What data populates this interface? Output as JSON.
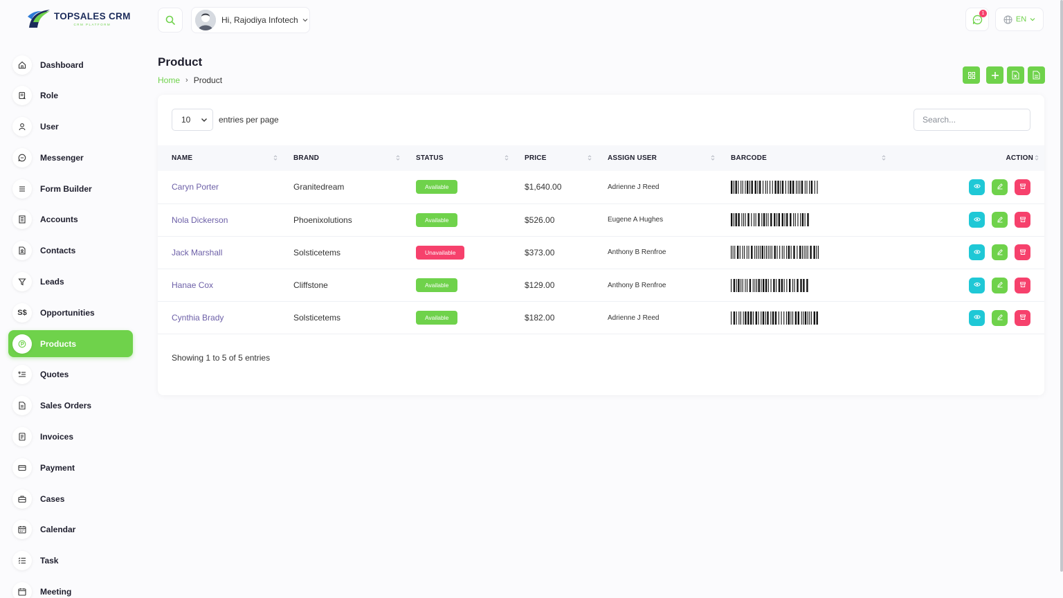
{
  "brand": {
    "title": "TOPSALES CRM",
    "subtitle": "CRM PLATFORM"
  },
  "header": {
    "greeting": "Hi, Rajodiya Infotech",
    "notifications": "1",
    "language": "EN"
  },
  "sidebar": {
    "items": [
      {
        "label": "Dashboard",
        "icon": "home-icon"
      },
      {
        "label": "Role",
        "icon": "role-icon"
      },
      {
        "label": "User",
        "icon": "user-icon"
      },
      {
        "label": "Messenger",
        "icon": "message-icon"
      },
      {
        "label": "Form Builder",
        "icon": "menu-icon"
      },
      {
        "label": "Accounts",
        "icon": "building-icon"
      },
      {
        "label": "Contacts",
        "icon": "file-user-icon"
      },
      {
        "label": "Leads",
        "icon": "filter-icon"
      },
      {
        "label": "Opportunities",
        "icon": "currency-icon",
        "glyph": "S$"
      },
      {
        "label": "Products",
        "icon": "product-icon",
        "active": true
      },
      {
        "label": "Quotes",
        "icon": "quote-icon"
      },
      {
        "label": "Sales Orders",
        "icon": "order-icon"
      },
      {
        "label": "Invoices",
        "icon": "invoice-icon"
      },
      {
        "label": "Payment",
        "icon": "credit-card-icon"
      },
      {
        "label": "Cases",
        "icon": "briefcase-icon"
      },
      {
        "label": "Calendar",
        "icon": "calendar-icon"
      },
      {
        "label": "Task",
        "icon": "list-check-icon"
      },
      {
        "label": "Meeting",
        "icon": "calendar-meeting-icon"
      }
    ]
  },
  "page": {
    "title": "Product",
    "breadcrumb": {
      "home": "Home",
      "separator": "›",
      "current": "Product"
    }
  },
  "table": {
    "per_page_value": "10",
    "per_page_label": "entries per page",
    "search_placeholder": "Search...",
    "columns": [
      "NAME",
      "BRAND",
      "STATUS",
      "PRICE",
      "ASSIGN USER",
      "BARCODE",
      "ACTION"
    ],
    "rows": [
      {
        "name": "Caryn Porter",
        "brand": "Granitedream",
        "status": "Available",
        "available": true,
        "price": "$1,640.00",
        "assign": "Adrienne J Reed"
      },
      {
        "name": "Nola Dickerson",
        "brand": "Phoenixolutions",
        "status": "Available",
        "available": true,
        "price": "$526.00",
        "assign": "Eugene A Hughes"
      },
      {
        "name": "Jack Marshall",
        "brand": "Solsticetems",
        "status": "Unavailable",
        "available": false,
        "price": "$373.00",
        "assign": "Anthony B Renfroe"
      },
      {
        "name": "Hanae Cox",
        "brand": "Cliffstone",
        "status": "Available",
        "available": true,
        "price": "$129.00",
        "assign": "Anthony B Renfroe"
      },
      {
        "name": "Cynthia Brady",
        "brand": "Solsticetems",
        "status": "Available",
        "available": true,
        "price": "$182.00",
        "assign": "Adrienne J Reed"
      }
    ],
    "footer": "Showing 1 to 5 of 5 entries"
  },
  "colors": {
    "accent": "#6fd24b",
    "danger": "#f6416c",
    "info": "#1fc8d6",
    "link": "#6c5fa7"
  }
}
